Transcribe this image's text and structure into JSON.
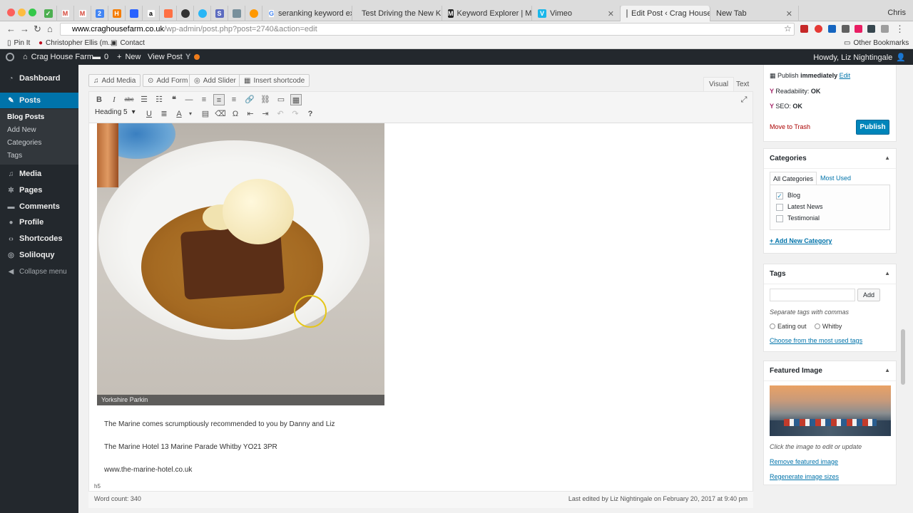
{
  "browser": {
    "tabs": [
      {
        "label": "seranking keyword exp",
        "active": false
      },
      {
        "label": "Test Driving the New K",
        "active": false
      },
      {
        "label": "Keyword Explorer | Moz",
        "active": false
      },
      {
        "label": "Vimeo",
        "active": false
      },
      {
        "label": "Edit Post ‹ Crag House",
        "active": true
      },
      {
        "label": "New Tab",
        "active": false
      }
    ],
    "user": "Chris",
    "url_host": "www.craghousefarm.co.uk",
    "url_path": "/wp-admin/post.php?post=2740&action=edit",
    "bookmarks": [
      "Pin It",
      "Christopher Ellis (m...",
      "Contact"
    ],
    "other_bookmarks": "Other Bookmarks"
  },
  "adminbar": {
    "site": "Crag House Farm",
    "comments": "0",
    "new": "New",
    "view_post": "View Post",
    "howdy": "Howdy, Liz Nightingale"
  },
  "sidebar": {
    "items": [
      {
        "label": "Dashboard"
      },
      {
        "label": "Posts"
      },
      {
        "label": "Media"
      },
      {
        "label": "Pages"
      },
      {
        "label": "Comments"
      },
      {
        "label": "Profile"
      },
      {
        "label": "Shortcodes"
      },
      {
        "label": "Soliloquy"
      },
      {
        "label": "Collapse menu"
      }
    ],
    "submenu": [
      "Blog Posts",
      "Add New",
      "Categories",
      "Tags"
    ]
  },
  "editor": {
    "media_buttons": [
      "Add Media",
      "Add Form",
      "Add Slider",
      "Insert shortcode"
    ],
    "tab_visual": "Visual",
    "tab_text": "Text",
    "format": "Heading 5",
    "image_caption": "Yorkshire Parkin",
    "paragraphs": [
      "The Marine comes scrumptiously recommended to you by Danny and Liz",
      "The Marine Hotel 13 Marine Parade Whitby YO21 3PR",
      "www.the-marine-hotel.co.uk"
    ],
    "path": "h5",
    "word_count": "Word count: 340",
    "last_edited": "Last edited by Liz Nightingale on February 20, 2017 at 9:40 pm"
  },
  "publish": {
    "publish_immediately": "Publish",
    "immediately": "immediately",
    "edit": "Edit",
    "readability_label": "Readability:",
    "readability": "OK",
    "seo_label": "SEO:",
    "seo": "OK",
    "trash": "Move to Trash",
    "button": "Publish"
  },
  "categories": {
    "title": "Categories",
    "tab_all": "All Categories",
    "tab_used": "Most Used",
    "items": [
      {
        "label": "Blog",
        "checked": true
      },
      {
        "label": "Latest News",
        "checked": false
      },
      {
        "label": "Testimonial",
        "checked": false
      }
    ],
    "add_new": "+ Add New Category"
  },
  "tags": {
    "title": "Tags",
    "add_button": "Add",
    "hint": "Separate tags with commas",
    "items": [
      "Eating out",
      "Whitby"
    ],
    "choose": "Choose from the most used tags"
  },
  "featured": {
    "title": "Featured Image",
    "hint": "Click the image to edit or update",
    "remove": "Remove featured image",
    "regenerate": "Regenerate image sizes"
  },
  "colors": {
    "accent": "#0073aa",
    "admin_bg": "#23282d",
    "trash": "#a00"
  }
}
